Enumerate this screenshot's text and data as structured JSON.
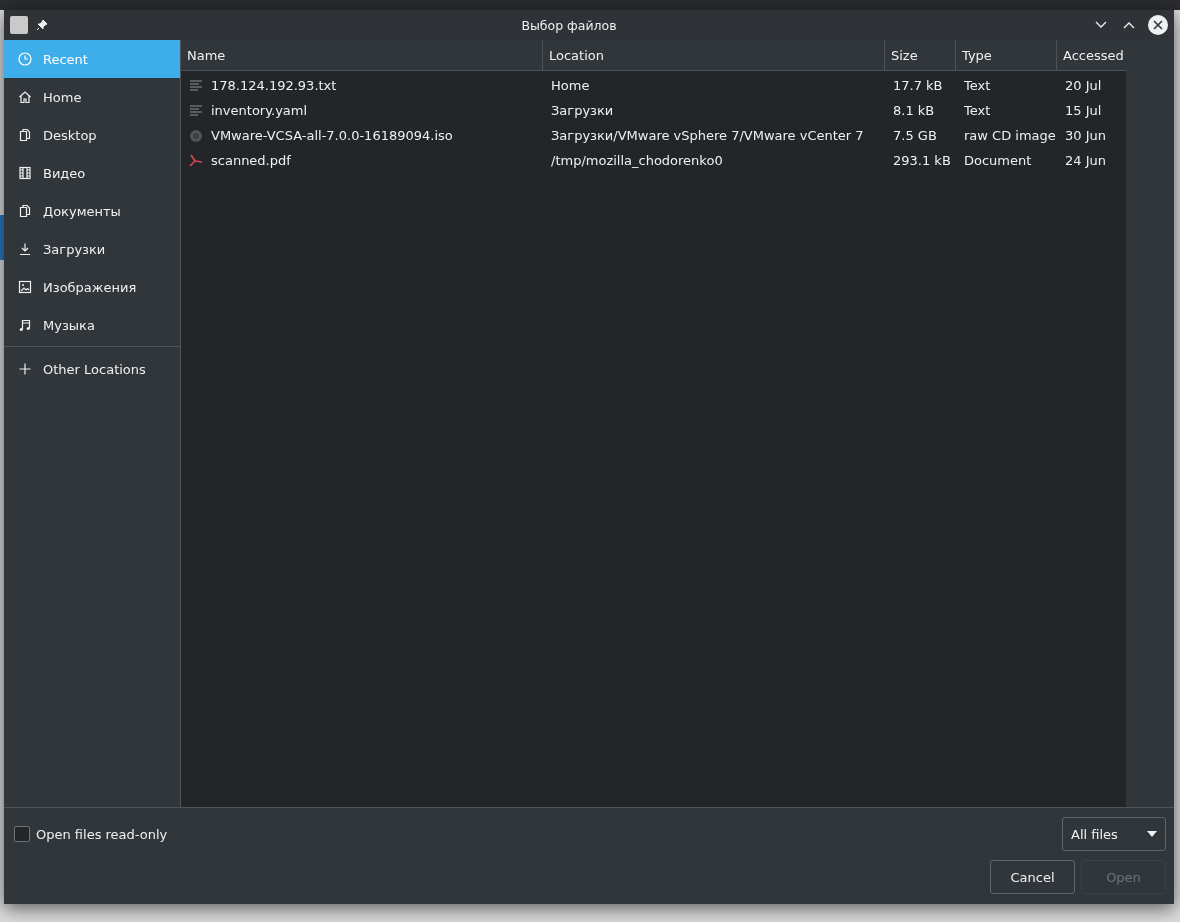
{
  "window": {
    "title": "Выбор файлов"
  },
  "sidebar": {
    "places": [
      {
        "label": "Recent",
        "selected": true
      },
      {
        "label": "Home",
        "selected": false
      },
      {
        "label": "Desktop",
        "selected": false
      },
      {
        "label": "Видео",
        "selected": false
      },
      {
        "label": "Документы",
        "selected": false
      },
      {
        "label": "Загрузки",
        "selected": false
      },
      {
        "label": "Изображения",
        "selected": false
      },
      {
        "label": "Музыка",
        "selected": false
      }
    ],
    "other": {
      "label": "Other Locations",
      "selected": false
    }
  },
  "table": {
    "columns": [
      "Name",
      "Location",
      "Size",
      "Type",
      "Accessed"
    ],
    "rows": [
      {
        "kind": "text",
        "name": "178.124.192.93.txt",
        "location": "Home",
        "size": "17.7 kB",
        "type": "Text",
        "accessed": "20 Jul"
      },
      {
        "kind": "text",
        "name": "inventory.yaml",
        "location": "Загрузки",
        "size": "8.1 kB",
        "type": "Text",
        "accessed": "15 Jul"
      },
      {
        "kind": "disc",
        "name": "VMware-VCSA-all-7.0.0-16189094.iso",
        "location": "Загрузки/VMware vSphere 7/VMware vCenter 7",
        "size": "7.5 GB",
        "type": "raw CD image",
        "accessed": "30 Jun"
      },
      {
        "kind": "pdf",
        "name": "scanned.pdf",
        "location": "/tmp/mozilla_chodorenko0",
        "size": "293.1 kB",
        "type": "Document",
        "accessed": "24 Jun"
      }
    ]
  },
  "options": {
    "read_only": {
      "label": "Open files read-only",
      "checked": false
    },
    "filter": {
      "value": "All files"
    }
  },
  "buttons": [
    {
      "label": "Cancel",
      "disabled": false
    },
    {
      "label": "Open",
      "disabled": true
    }
  ]
}
